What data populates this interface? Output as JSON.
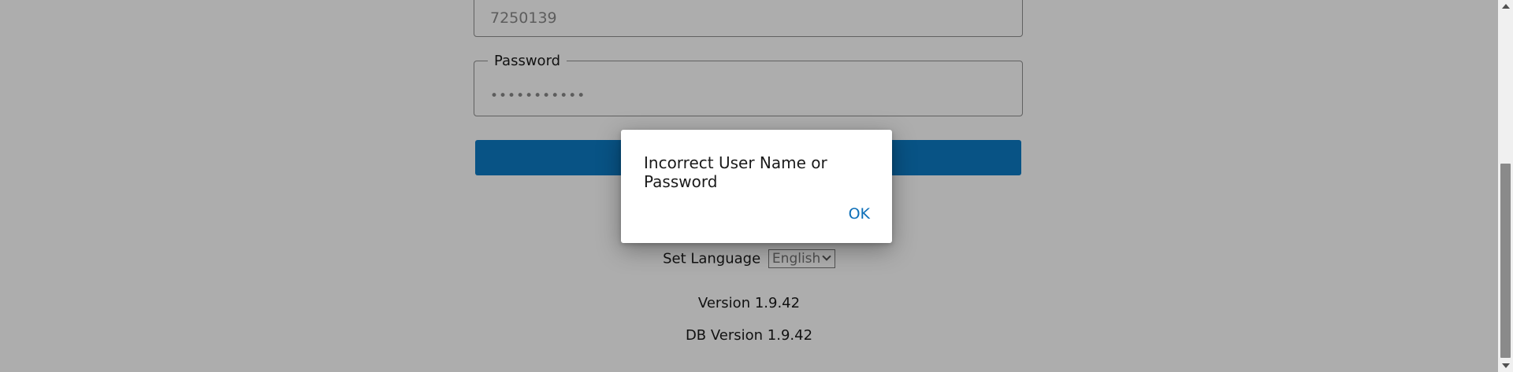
{
  "login_form": {
    "username_value": "7250139",
    "password_label": "Password",
    "password_value": "•••••••••••"
  },
  "language": {
    "label": "Set Language",
    "selected": "English"
  },
  "footer": {
    "version": "Version 1.9.42",
    "db_version": "DB Version 1.9.42"
  },
  "dialog": {
    "message": "Incorrect User Name or Password",
    "ok_label": "OK"
  },
  "colors": {
    "primary_button": "#0d7bc4",
    "link": "#0d6fb8"
  }
}
